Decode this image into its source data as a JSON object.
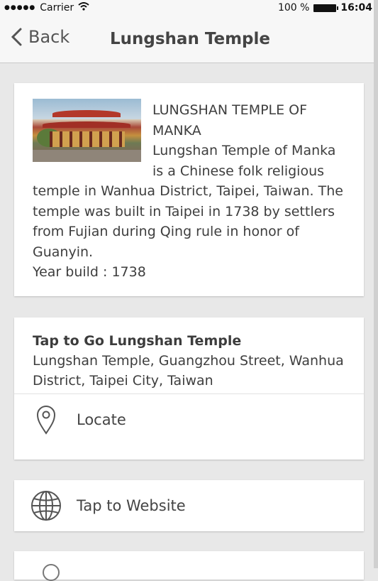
{
  "status_bar": {
    "carrier": "Carrier",
    "battery_percent": "100 %",
    "time": "16:04"
  },
  "nav": {
    "back_label": "Back",
    "title": "Lungshan Temple"
  },
  "description": {
    "image_icon": "temple-photo",
    "title": "LUNGSHAN TEMPLE OF MANKA",
    "body": "Lungshan Temple of Manka is a Chinese folk religious temple in Wanhua District, Taipei, Taiwan. The temple was built in Taipei in 1738 by settlers from Fujian during Qing rule in honor of Guanyin.",
    "year_built": "Year build : 1738"
  },
  "location": {
    "title": "Tap to Go Lungshan Temple",
    "address": "Lungshan Temple, Guangzhou Street, Wanhua District, Taipei City, Taiwan",
    "locate_label": "Locate",
    "locate_icon": "map-pin-icon"
  },
  "website": {
    "label": "Tap to Website",
    "icon": "globe-icon"
  }
}
